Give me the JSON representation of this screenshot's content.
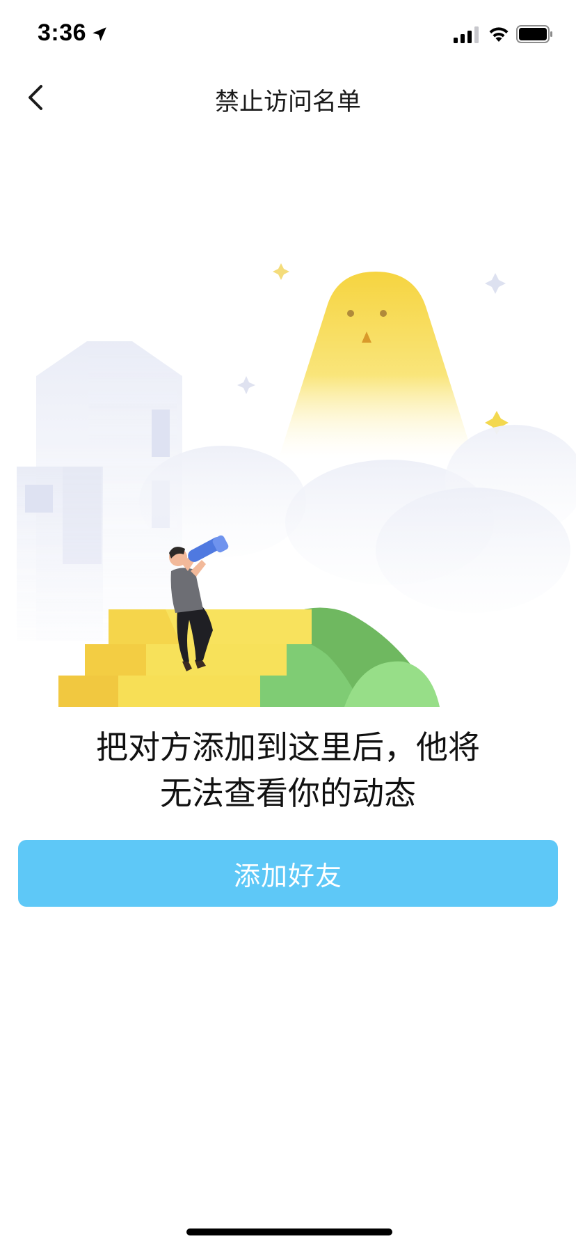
{
  "status_bar": {
    "time": "3:36",
    "icons": [
      "location-arrow-icon",
      "cellular-signal-icon",
      "wifi-icon",
      "battery-icon"
    ]
  },
  "nav": {
    "title": "禁止访问名单",
    "back_icon": "chevron-left-icon"
  },
  "empty_state": {
    "illustration": "person-with-telescope-on-steps",
    "message_line1": "把对方添加到这里后，他将",
    "message_line2": "无法查看你的动态"
  },
  "actions": {
    "add_friend_label": "添加好友"
  },
  "colors": {
    "button_bg": "#5ec8f7",
    "button_text": "#ffffff",
    "sun_yellow": "#f7d94a",
    "stairs_yellow": "#f3cf47",
    "hill_green": "#6fbf5e"
  }
}
